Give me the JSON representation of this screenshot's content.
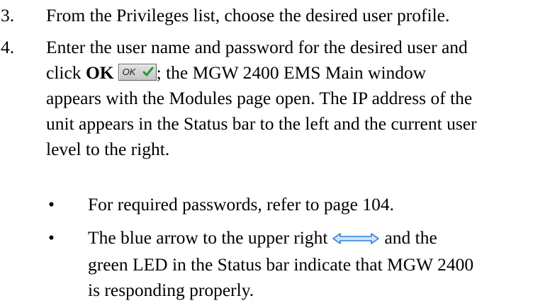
{
  "steps": [
    {
      "number": "3.",
      "text": "From the Privileges list, choose the desired user profile."
    },
    {
      "number": "4.",
      "line1": "Enter the user name and password for the desired user and",
      "line2_pre": "click ",
      "line2_bold": "OK",
      "ok_button_label": "OK",
      "line2_post": "; the MGW 2400 EMS Main window",
      "line3": "appears with the Modules page open. The IP address of the",
      "line4": "unit appears in the Status bar to the left and the current user",
      "line5": "level to the right."
    }
  ],
  "bullets": [
    {
      "symbol": "•",
      "text": "For required passwords, refer to page 104."
    },
    {
      "symbol": "•",
      "line1_pre": "The blue arrow to the upper right",
      "line1_post": "and the",
      "line2": "green LED in the Status bar indicate that MGW 2400",
      "line3": "is responding properly."
    }
  ],
  "icons": {
    "ok_check": "checkmark-icon",
    "arrow": "double-arrow-icon"
  },
  "colors": {
    "arrow_blue": "#2a7fd6",
    "check_green": "#1e9a1e"
  }
}
